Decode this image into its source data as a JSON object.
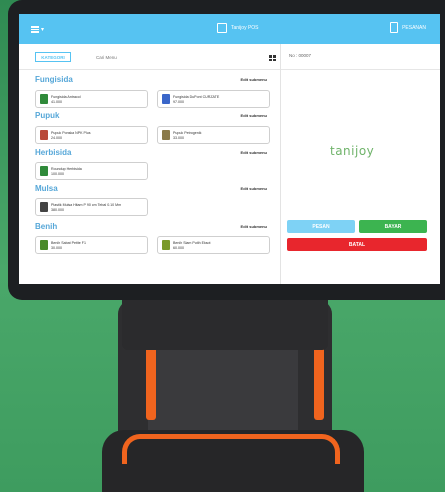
{
  "header": {
    "title": "Tanijoy POS",
    "orders_label": "PESANAN"
  },
  "toolbar": {
    "category_button": "KATEGORI",
    "search_placeholder": "Cari Menu"
  },
  "categories": [
    {
      "name": "Fungisida",
      "edit_label": "Edit submenu",
      "items": [
        {
          "name": "Fungisida Antracol",
          "price": "41.000",
          "color": "#2f8a3a"
        },
        {
          "name": "Fungisida DuPont CURZATE",
          "price": "97.000",
          "color": "#3a66c9"
        }
      ]
    },
    {
      "name": "Pupuk",
      "edit_label": "Edit submenu",
      "items": [
        {
          "name": "Pupuk Ponska NPK Plus",
          "price": "24.000",
          "color": "#b94a3a"
        },
        {
          "name": "Pupuk Petrogenik",
          "price": "33.000",
          "color": "#8a7a4a"
        }
      ]
    },
    {
      "name": "Herbisida",
      "edit_label": "Edit submenu",
      "items": [
        {
          "name": "Roundup Herbisida",
          "price": "100.000",
          "color": "#2f8a3a"
        }
      ]
    },
    {
      "name": "Mulsa",
      "edit_label": "Edit submenu",
      "items": [
        {
          "name": "Plastik Mulsa Hitam P 90 cm Tebal 0.10 Mm",
          "price": "380.000",
          "color": "#444444"
        }
      ]
    },
    {
      "name": "Benih",
      "edit_label": "Edit submenu",
      "items": [
        {
          "name": "Benih Sabat Petite F1",
          "price": "30.000",
          "color": "#4a8a2a"
        },
        {
          "name": "Benih Siam Putih Eksot",
          "price": "60.000",
          "color": "#7a9a2a"
        }
      ]
    }
  ],
  "order_panel": {
    "number_label": "No : 00007",
    "logo_text": "tanijoy",
    "pesan_label": "PESAN",
    "bayar_label": "BAYAR",
    "batal_label": "BATAL"
  },
  "colors": {
    "accent": "#56c3f2",
    "bayar": "#3cb450",
    "batal": "#e8262d",
    "pesan": "#7ed2f5"
  }
}
